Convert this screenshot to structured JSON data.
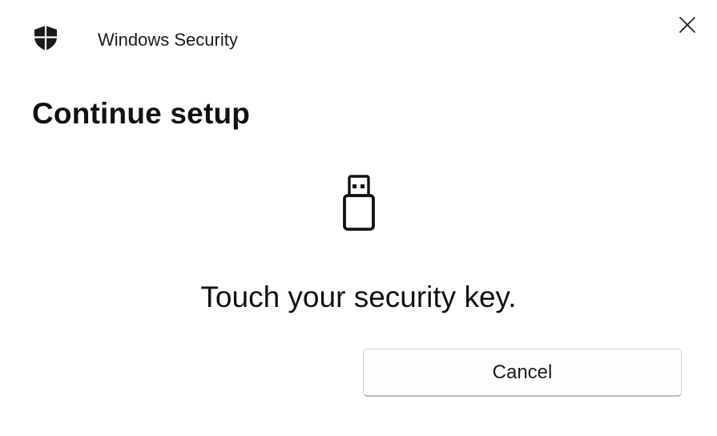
{
  "window": {
    "title": "Windows Security",
    "app_icon": "shield-icon",
    "close_icon": "close-icon"
  },
  "main": {
    "heading": "Continue setup",
    "illustration_icon": "usb-security-key-icon",
    "message": "Touch your security key."
  },
  "actions": {
    "cancel_label": "Cancel"
  },
  "colors": {
    "background": "#ffffff",
    "text": "#111111",
    "button_border": "#d3d3d3"
  }
}
